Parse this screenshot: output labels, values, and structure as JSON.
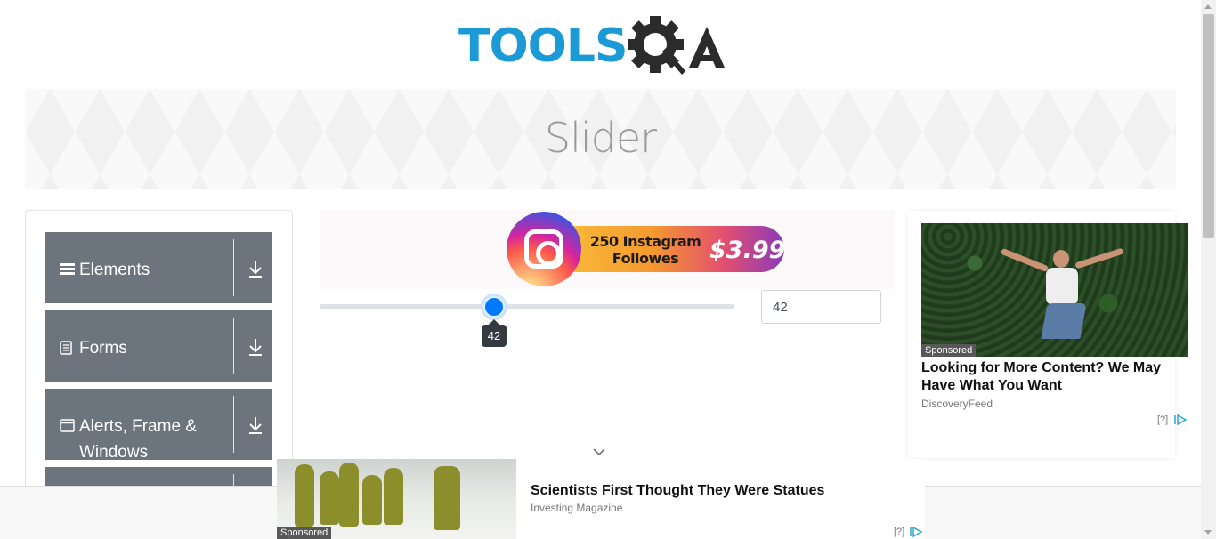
{
  "logo": {
    "text_tools": "TOOLS",
    "text_qa": "QA",
    "icon": "gear-icon"
  },
  "banner": {
    "title": "Slider"
  },
  "sidebar": {
    "groups": [
      {
        "label": "Elements",
        "icon": "menu-icon"
      },
      {
        "label": "Forms",
        "icon": "form-icon"
      },
      {
        "label": "Alerts, Frame & Windows",
        "icon": "window-icon"
      },
      {
        "label": "",
        "icon": ""
      }
    ]
  },
  "promo": {
    "line1": "250 Instagram",
    "line2": "Followes",
    "price": "$3.99"
  },
  "slider": {
    "value": "42",
    "min": 0,
    "max": 100,
    "tooltip": "42"
  },
  "right_ad": {
    "sponsored": "Sponsored",
    "title": "Looking for More Content? We May Have What You Want",
    "source": "DiscoveryFeed",
    "adchoice": "[?]"
  },
  "bottom_ad": {
    "sponsored": "Sponsored",
    "title": "Scientists First Thought They Were Statues",
    "source": "Investing Magazine",
    "adchoice": "[?]"
  },
  "colors": {
    "accent": "#007bff",
    "sidebar_bg": "#6c757d",
    "logo_blue": "#1b9ad6"
  }
}
